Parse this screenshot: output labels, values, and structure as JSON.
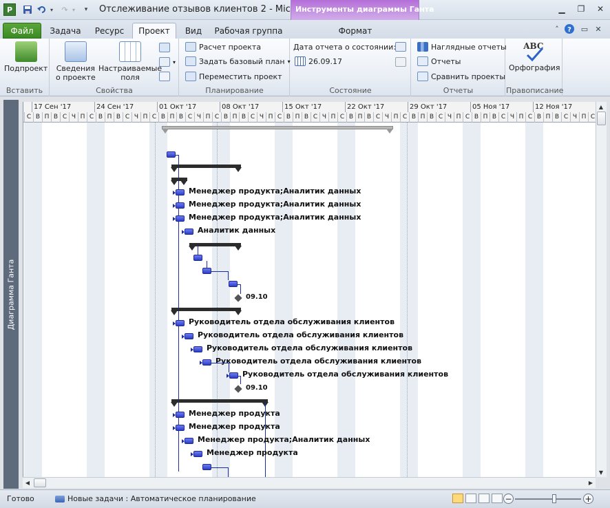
{
  "window": {
    "title": "Отслеживание отзывов клиентов 2  -  Micr...",
    "contextual_title": "Инструменты диаграммы Ганта",
    "app_icon": "P"
  },
  "tabs": {
    "file": "Файл",
    "task": "Задача",
    "resource": "Ресурс",
    "project": "Проект",
    "view": "Вид",
    "team": "Рабочая группа",
    "format": "Формат"
  },
  "ribbon": {
    "insert": {
      "subproject": "Подпроект",
      "group": "Вставить"
    },
    "properties": {
      "project_info_1": "Сведения",
      "project_info_2": "о проекте",
      "custom_fields_1": "Настраиваемые",
      "custom_fields_2": "поля",
      "group": "Свойства"
    },
    "schedule": {
      "calculate": "Расчет проекта",
      "set_baseline": "Задать базовый план",
      "move_project": "Переместить проект",
      "group": "Планирование"
    },
    "status": {
      "status_date_label": "Дата отчета о состоянии:",
      "status_date": "26.09.17",
      "group": "Состояние"
    },
    "reports": {
      "visual_reports": "Наглядные отчеты",
      "reports": "Отчеты",
      "compare": "Сравнить проекты",
      "group": "Отчеты"
    },
    "proofing": {
      "spelling": "Орфография",
      "group": "Правописание",
      "icon_text": "ABC"
    }
  },
  "side_label": "Диаграмма Ганта",
  "timescale": {
    "weeks": [
      "17 Сен '17",
      "24 Сен '17",
      "01 Окт '17",
      "08 Окт '17",
      "15 Окт '17",
      "22 Окт '17",
      "29 Окт '17",
      "05 Ноя '17",
      "12 Ноя '17"
    ],
    "days": [
      "С",
      "В",
      "П",
      "В",
      "С",
      "Ч",
      "П",
      "С",
      "В",
      "П",
      "В",
      "С",
      "Ч",
      "П",
      "С",
      "В",
      "П",
      "В",
      "С",
      "Ч",
      "П",
      "С",
      "В",
      "П",
      "В",
      "С",
      "Ч",
      "П",
      "С",
      "В",
      "П",
      "В",
      "С",
      "Ч",
      "П",
      "С",
      "В",
      "П",
      "В",
      "С",
      "Ч",
      "П",
      "С",
      "В",
      "П",
      "В",
      "С",
      "Ч",
      "П",
      "С",
      "В",
      "П",
      "В",
      "С",
      "Ч",
      "П",
      "С",
      "В",
      "П",
      "В",
      "С",
      "Ч",
      "П",
      "С"
    ]
  },
  "tasks": [
    {
      "label": "Менеджер продукта;Аналитик данных"
    },
    {
      "label": "Менеджер продукта;Аналитик данных"
    },
    {
      "label": "Менеджер продукта;Аналитик данных"
    },
    {
      "label": "Аналитик данных"
    },
    {
      "label": "09.10"
    },
    {
      "label": "Руководитель отдела обслуживания клиентов"
    },
    {
      "label": "Руководитель отдела обслуживания клиентов"
    },
    {
      "label": "Руководитель отдела обслуживания клиентов"
    },
    {
      "label": "Руководитель отдела обслуживания клиентов"
    },
    {
      "label": "Руководитель отдела обслуживания клиентов"
    },
    {
      "label": "09.10"
    },
    {
      "label": "Менеджер продукта"
    },
    {
      "label": "Менеджер продукта"
    },
    {
      "label": "Менеджер продукта;Аналитик данных"
    },
    {
      "label": "Менеджер продукта"
    }
  ],
  "statusbar": {
    "ready": "Готово",
    "mode": "Новые задачи : Автоматическое планирование"
  },
  "colors": {
    "task_bar": "#2d3ec4",
    "summary_bar": "#2c2c2c",
    "file_tab": "#3a8a23",
    "contextual": "#b46ed8"
  }
}
